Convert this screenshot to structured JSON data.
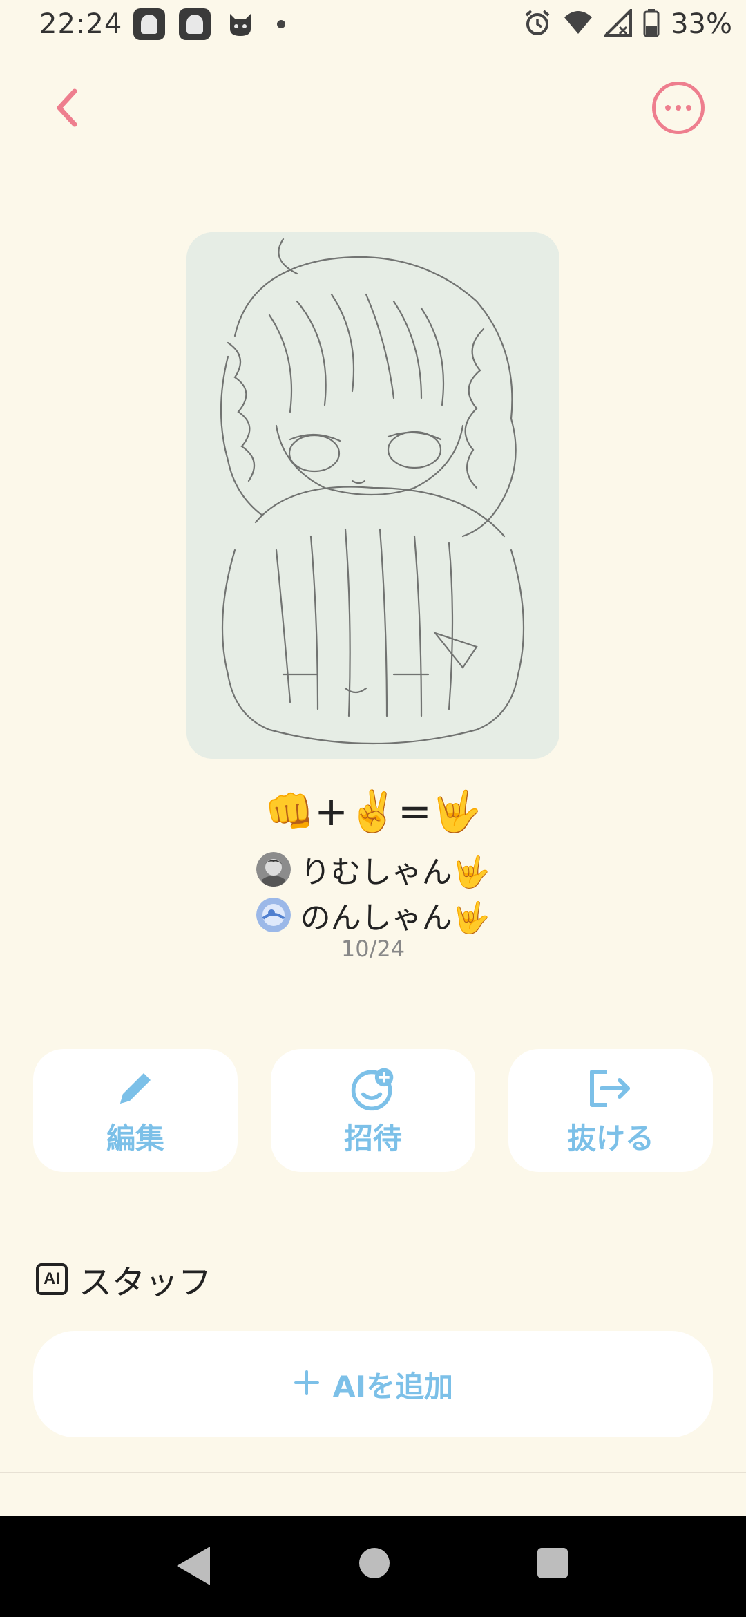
{
  "status_bar": {
    "time": "22:24",
    "battery": "33%",
    "icons": [
      "app-notification-icon",
      "app-notification-icon",
      "cat-icon",
      "dot-icon",
      "alarm-icon",
      "wifi-icon",
      "signal-icon",
      "battery-icon"
    ]
  },
  "header": {
    "back_icon": "chevron-left-icon",
    "more_icon": "more-horizontal-icon"
  },
  "group": {
    "title": "👊+✌️=🤟",
    "members": [
      {
        "name": "りむしゃん🤟",
        "avatar": "avatar-gray"
      },
      {
        "name": "のんしゃん🤟",
        "avatar": "avatar-blue"
      }
    ],
    "date": "10/24"
  },
  "actions": [
    {
      "label": "編集",
      "icon": "pencil-icon"
    },
    {
      "label": "招待",
      "icon": "invite-face-icon"
    },
    {
      "label": "抜ける",
      "icon": "exit-icon"
    }
  ],
  "staff": {
    "badge": "AI",
    "title": "スタッフ",
    "add_label": "AIを追加",
    "add_icon": "plus-icon"
  },
  "colors": {
    "background": "#FCF8EA",
    "accent_pink": "#EE7E8E",
    "accent_blue": "#7CC0E8"
  }
}
